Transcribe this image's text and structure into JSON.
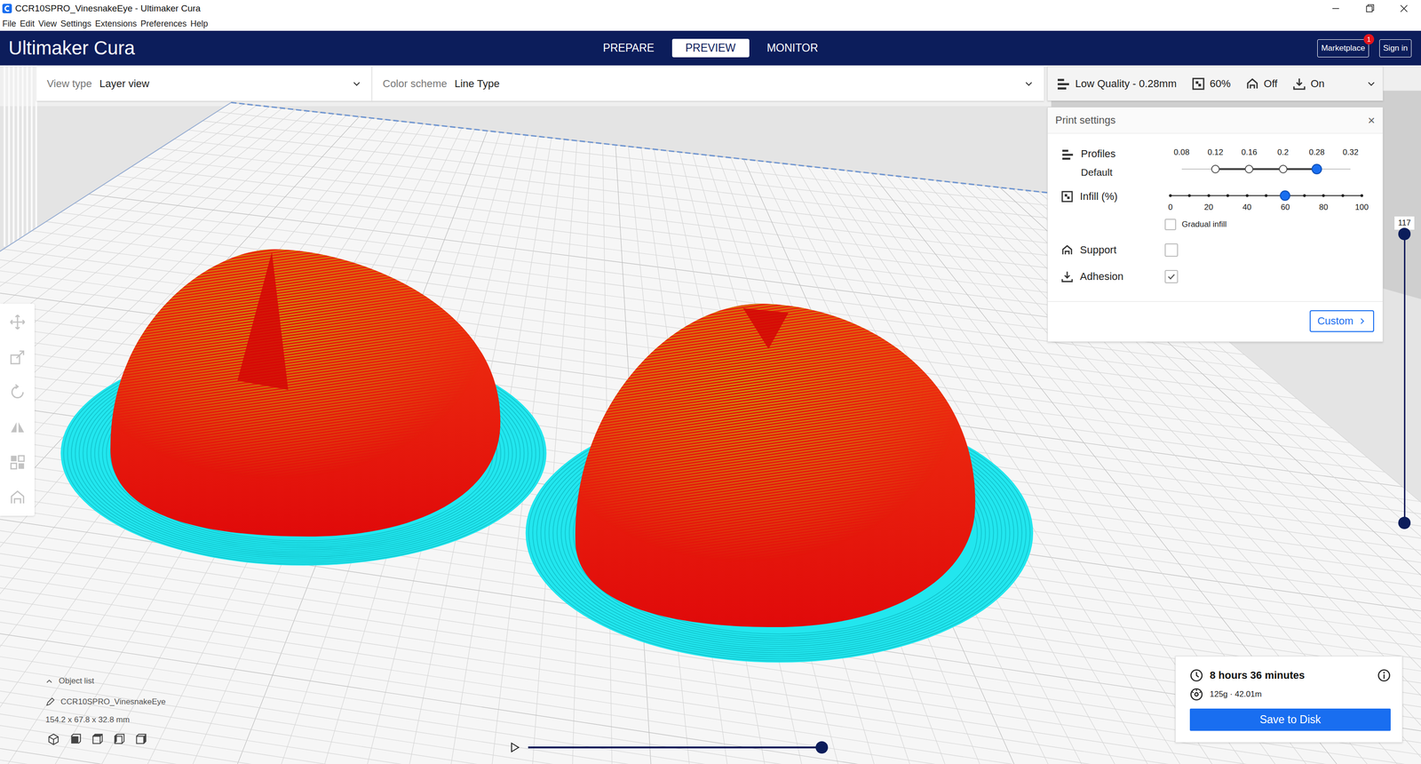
{
  "window": {
    "title": "CCR10SPRO_VinesnakeEye - Ultimaker Cura"
  },
  "menu": [
    "File",
    "Edit",
    "View",
    "Settings",
    "Extensions",
    "Preferences",
    "Help"
  ],
  "header": {
    "logo": "Ultimaker Cura",
    "tabs": [
      {
        "label": "PREPARE",
        "selected": false
      },
      {
        "label": "PREVIEW",
        "selected": true
      },
      {
        "label": "MONITOR",
        "selected": false
      }
    ],
    "marketplace": {
      "label": "Marketplace",
      "badge": "1"
    },
    "sign_in": "Sign in"
  },
  "toolbar": {
    "view_type": {
      "label": "View type",
      "value": "Layer view"
    },
    "color_scheme": {
      "label": "Color scheme",
      "value": "Line Type"
    },
    "print_summary": {
      "profile": "Low Quality - 0.28mm",
      "infill": "60%",
      "support": "Off",
      "adhesion": "On"
    }
  },
  "print_settings": {
    "title": "Print settings",
    "close": "×",
    "profiles": {
      "label": "Profiles",
      "value": "Default",
      "options": [
        {
          "label": "0.08",
          "kind": "empty",
          "selected": false
        },
        {
          "label": "0.12",
          "kind": "node",
          "selected": false
        },
        {
          "label": "0.16",
          "kind": "node",
          "selected": false
        },
        {
          "label": "0.2",
          "kind": "node",
          "selected": false
        },
        {
          "label": "0.28",
          "kind": "node",
          "selected": true
        },
        {
          "label": "0.32",
          "kind": "empty",
          "selected": false
        }
      ]
    },
    "infill": {
      "label": "Infill (%)",
      "ticks": [
        "0",
        "20",
        "40",
        "60",
        "80",
        "100"
      ],
      "level": 0.6,
      "gradual": {
        "label": "Gradual infill",
        "checked": false
      }
    },
    "support": {
      "label": "Support",
      "checked": false
    },
    "adhesion": {
      "label": "Adhesion",
      "checked": true
    },
    "custom_button": "Custom"
  },
  "layer_slider": {
    "label": "117",
    "high": 1,
    "low": 0
  },
  "playback": {
    "level": 1
  },
  "object_list": {
    "header": "Object list",
    "expanded": true,
    "name": "CCR10SPRO_VinesnakeEye",
    "dimensions": "154.2 x 67.8 x 32.8 mm"
  },
  "print_info": {
    "time": "8 hours 36 minutes",
    "material": "125g · 42.01m",
    "save_button": "Save to Disk"
  }
}
